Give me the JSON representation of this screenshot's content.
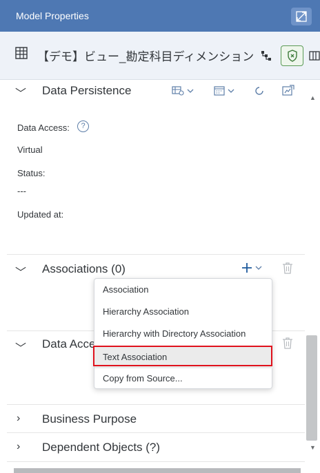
{
  "window": {
    "title": "Model Properties"
  },
  "object": {
    "name": "【デモ】ビュー_勘定科目ディメンション"
  },
  "sections": {
    "data_persistence": {
      "title": "Data Persistence",
      "data_access_label": "Data Access:",
      "data_access_value": "Virtual",
      "status_label": "Status:",
      "status_value": "---",
      "updated_label": "Updated at:"
    },
    "associations": {
      "title": "Associations (0)"
    },
    "data_access": {
      "title": "Data Acce"
    },
    "business_purpose": {
      "title": "Business Purpose"
    },
    "dependent_objects": {
      "title": "Dependent Objects (?)"
    }
  },
  "help_icon_label": "?",
  "add_menu": {
    "items": [
      {
        "label": "Association"
      },
      {
        "label": "Hierarchy Association"
      },
      {
        "label": "Hierarchy with Directory Association"
      },
      {
        "label": "Text Association"
      },
      {
        "label": "Copy from Source..."
      }
    ],
    "highlighted_index": 3
  },
  "colors": {
    "header": "#4e78b3",
    "accent": "#0a6ed1",
    "highlight": "#e0111c"
  }
}
